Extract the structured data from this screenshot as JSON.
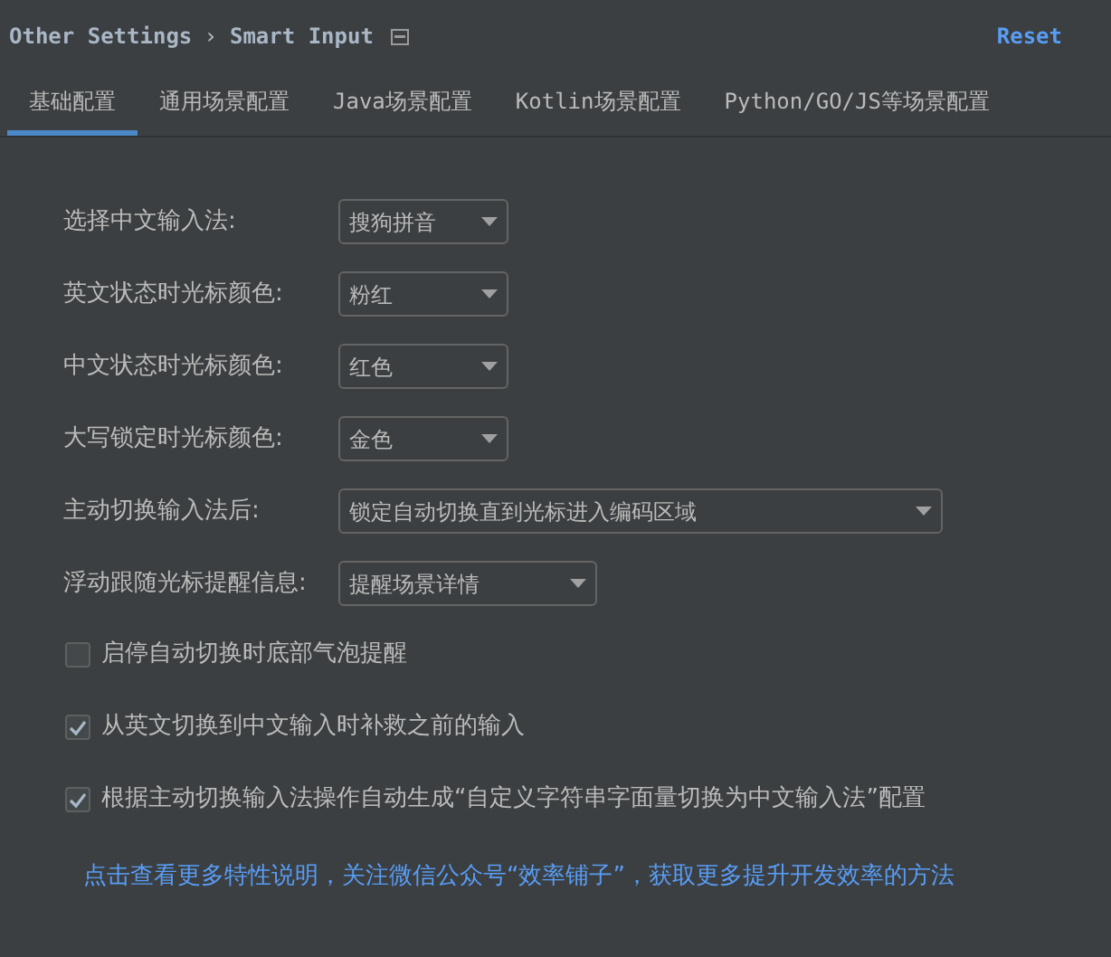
{
  "breadcrumb": {
    "parent": "Other Settings",
    "separator": "›",
    "current": "Smart Input"
  },
  "reset": "Reset",
  "tabs": [
    {
      "label": "基础配置",
      "selected": true
    },
    {
      "label": "通用场景配置",
      "selected": false
    },
    {
      "label": "Java场景配置",
      "selected": false
    },
    {
      "label": "Kotlin场景配置",
      "selected": false
    },
    {
      "label": "Python/GO/JS等场景配置",
      "selected": false
    }
  ],
  "fields": [
    {
      "label": "选择中文输入法:",
      "value": "搜狗拼音"
    },
    {
      "label": "英文状态时光标颜色:",
      "value": "粉红"
    },
    {
      "label": "中文状态时光标颜色:",
      "value": "红色"
    },
    {
      "label": "大写锁定时光标颜色:",
      "value": "金色"
    },
    {
      "label": "主动切换输入法后:",
      "value": "锁定自动切换直到光标进入编码区域"
    },
    {
      "label": "浮动跟随光标提醒信息:",
      "value": "提醒场景详情"
    }
  ],
  "checkboxes": [
    {
      "label": "启停自动切换时底部气泡提醒",
      "checked": false
    },
    {
      "label": "从英文切换到中文输入时补救之前的输入",
      "checked": true
    },
    {
      "label": "根据主动切换输入法操作自动生成“自定义字符串字面量切换为中文输入法”配置",
      "checked": true
    }
  ],
  "link": "点击查看更多特性说明，关注微信公众号“效率铺子”，获取更多提升开发效率的方法"
}
